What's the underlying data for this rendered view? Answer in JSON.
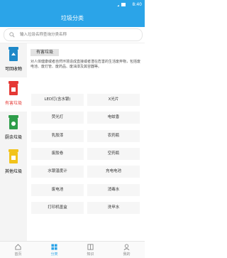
{
  "status": {
    "time": "8:40"
  },
  "title": "垃圾分类",
  "search": {
    "placeholder": "输入垃圾名称查询分类名称"
  },
  "categories": [
    {
      "label": "可回收物",
      "color": "#1e88c8"
    },
    {
      "label": "有害垃圾",
      "color": "#e53935"
    },
    {
      "label": "厨余垃圾",
      "color": "#2e9d4a"
    },
    {
      "label": "其他垃圾",
      "color": "#f2c31b"
    }
  ],
  "content": {
    "heading": "有害垃圾",
    "description": "对人体健康或者自然环境造成直接或者潜在危害的生活废弃物，包括废电池、废灯管、废药品、废油漆及其容器等。"
  },
  "items": [
    "LED灯(含水银)",
    "X光片",
    "荧光灯",
    "电蚊香",
    "乳胶漆",
    "农药瓶",
    "废胶卷",
    "空药瓶",
    "水银温度计",
    "充电电池",
    "废电池",
    "消毒水",
    "打印机墨盒",
    "洗甲水"
  ],
  "tabs": [
    {
      "label": "首页",
      "active": false
    },
    {
      "label": "分类",
      "active": true
    },
    {
      "label": "知识",
      "active": false
    },
    {
      "label": "我的",
      "active": false
    }
  ],
  "colors": {
    "accent": "#2ba4e8"
  }
}
